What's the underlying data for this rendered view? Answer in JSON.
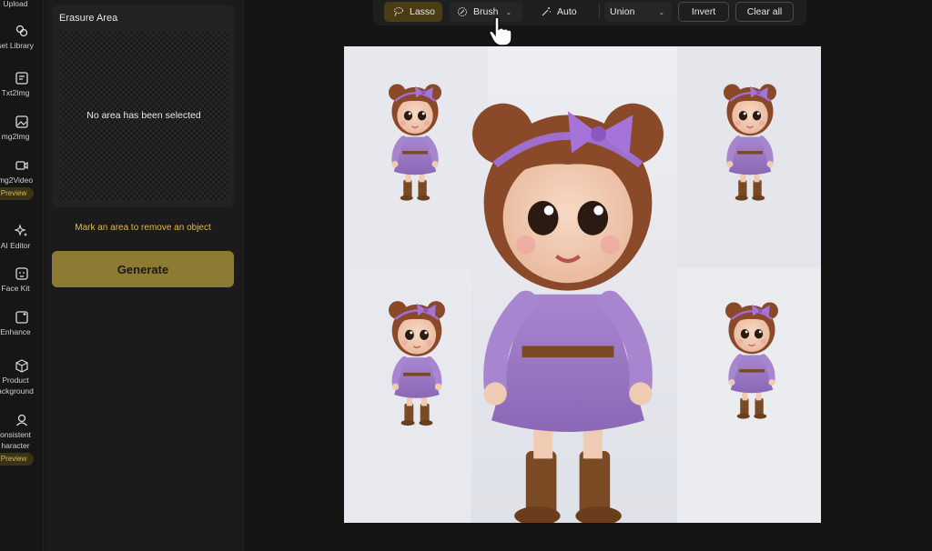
{
  "rail": {
    "items": [
      {
        "label": "Upload"
      },
      {
        "label": "set Library"
      },
      {
        "label": "Txt2Img"
      },
      {
        "label": "mg2Img"
      },
      {
        "label": "mg2Video",
        "badge": "Preview"
      },
      {
        "label": "AI Editor"
      },
      {
        "label": "Face Kit"
      },
      {
        "label": "Enhance"
      },
      {
        "label": "Product",
        "label2": "ackground"
      },
      {
        "label": "onsistent",
        "label2": "haracter",
        "badge": "Preview"
      }
    ]
  },
  "panel": {
    "erase_title": "Erasure Area",
    "empty_text": "No area has been selected",
    "hint": "Mark an area to remove an object",
    "generate_label": "Generate"
  },
  "toolbar": {
    "lasso": "Lasso",
    "brush": "Brush",
    "auto": "Auto",
    "mode": "Union",
    "invert": "Invert",
    "clear": "Clear all"
  },
  "colors": {
    "accent": "#8d7a33",
    "hint": "#e2b84a",
    "dress": "#9f7cc6",
    "hair": "#8a4a2a",
    "boots": "#7a4a24"
  }
}
